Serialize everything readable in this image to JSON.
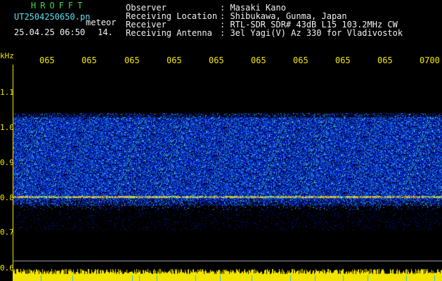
{
  "header": {
    "brand": "HROFFT",
    "filename": "UT2504250650.pn",
    "event": "meteor",
    "datetime": "25.04.25 06:50",
    "count": "14."
  },
  "info": {
    "labels": [
      "Observer",
      "Receiving Location",
      "Receiver",
      "Receiving Antenna"
    ],
    "values": [
      ": Masaki Kano",
      ": Shibukawa, Gunma, Japan",
      ": RTL-SDR SDR# 43dB L15 103.2MHz CW",
      ": 3el Yagi(V) Az 330 for Vladivostok"
    ]
  },
  "axis": {
    "y_unit": "kHz",
    "y_ticks": [
      "1.1",
      "1.0",
      "0.9",
      "0.8",
      "0.7",
      "0.6"
    ],
    "x_ticks": [
      "065",
      "065",
      "065",
      "065",
      "065",
      "065",
      "065",
      "065",
      "065",
      "0700"
    ]
  },
  "colors": {
    "text_header": "#3ddc3d",
    "text_info": "#f2f2f2",
    "axis": "#f2e600",
    "spectrum_signal": "#2a4dff",
    "trail_orange": "#ff8a1a",
    "noise_floor": "#f2e600"
  }
}
